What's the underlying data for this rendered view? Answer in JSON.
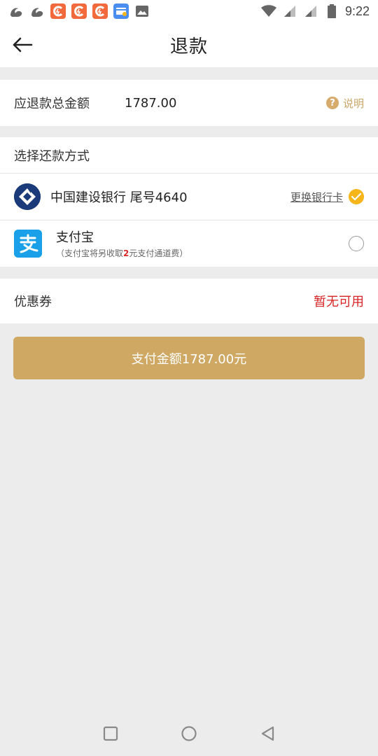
{
  "status_bar": {
    "time": "9:22",
    "notification_icons": [
      "uc-browser-icon",
      "uc-browser-icon",
      "app-c-icon",
      "app-c-icon",
      "app-c-icon",
      "wallet-card-icon",
      "image-icon"
    ],
    "system_icons": [
      "wifi-icon",
      "signal-icon",
      "signal-icon",
      "battery-icon"
    ]
  },
  "header": {
    "title": "退款"
  },
  "total": {
    "label": "应退款总金额",
    "value": "1787.00",
    "help_label": "说明"
  },
  "payment": {
    "title": "选择还款方式",
    "methods": [
      {
        "name": "中国建设银行 尾号4640",
        "action": "更换银行卡",
        "selected": true
      },
      {
        "name": "支付宝",
        "note_prefix": "（支付宝将另收取",
        "note_fee": "2",
        "note_suffix": "元支付通道费）",
        "selected": false
      }
    ]
  },
  "coupon": {
    "label": "优惠券",
    "value": "暂无可用"
  },
  "pay_button": {
    "label": "支付金额1787.00元"
  },
  "colors": {
    "accent_gold": "#cfa864",
    "help_gold": "#c8a465",
    "check_yellow": "#f5b51b",
    "coupon_red": "#d72527",
    "bank_blue": "#1a3a7a",
    "alipay_blue": "#1aa0e8",
    "background": "#ececec"
  }
}
